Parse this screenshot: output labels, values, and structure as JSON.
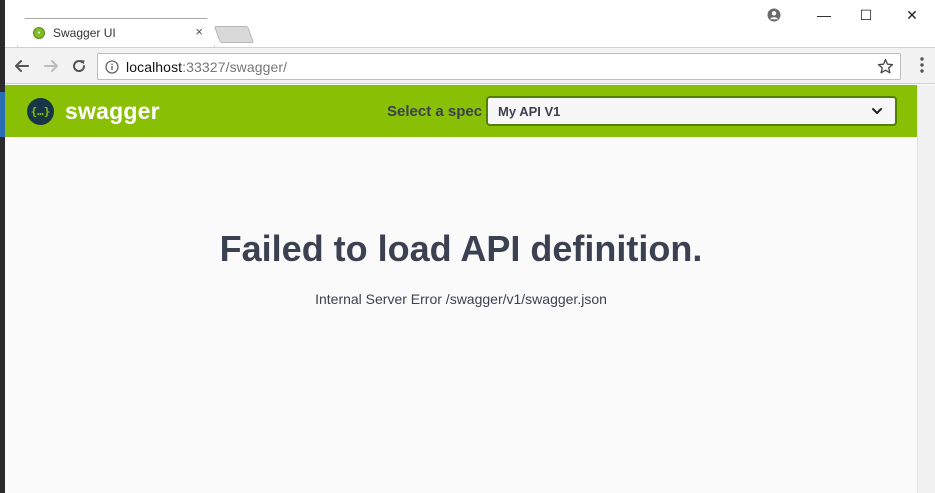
{
  "browser": {
    "tab_title": "Swagger UI",
    "tab_close": "×",
    "url_host": "localhost",
    "url_rest": ":33327/swagger/",
    "window_controls": {
      "minimize": "—",
      "maximize": "☐",
      "close": "✕"
    }
  },
  "swagger": {
    "logo_text": "swagger",
    "logo_glyph": "{…}",
    "spec_label": "Select a spec",
    "spec_selected": "My API V1",
    "brand_color": "#89bf04"
  },
  "error": {
    "title": "Failed to load API definition.",
    "message": "Internal Server Error /swagger/v1/swagger.json"
  },
  "icons": [
    "swagger-favicon-icon",
    "close-icon",
    "profile-icon",
    "minimize-icon",
    "maximize-icon",
    "window-close-icon",
    "back-arrow-icon",
    "forward-arrow-icon",
    "reload-icon",
    "info-icon",
    "star-icon",
    "menu-dots-icon",
    "swagger-logo-icon",
    "chevron-down-icon"
  ]
}
